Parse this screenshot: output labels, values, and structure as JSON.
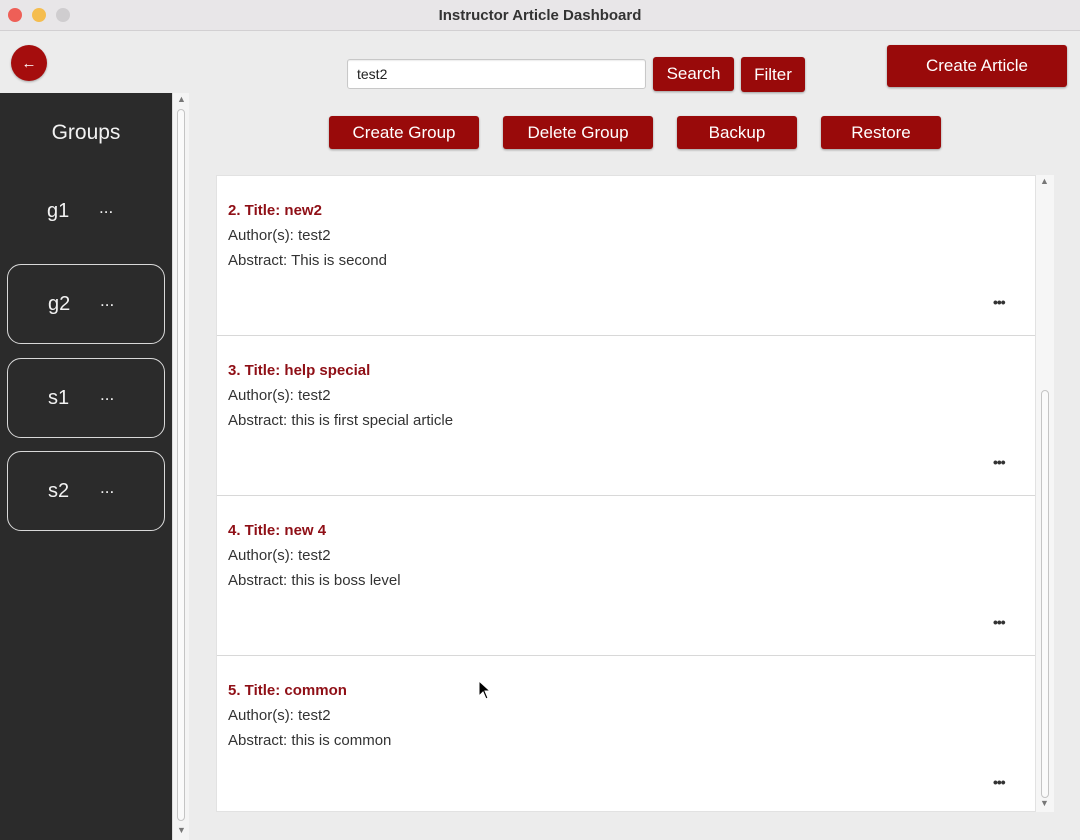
{
  "window": {
    "title": "Instructor Article Dashboard"
  },
  "icons": {
    "back": "arrow-left-icon",
    "more": "ellipsis-icon"
  },
  "colors": {
    "accent": "#990a0a",
    "title_text": "#8f0f16",
    "sidebar_bg": "#2b2b2b"
  },
  "back_button": {
    "label": "←"
  },
  "search": {
    "value": "test2"
  },
  "toolbar": {
    "search_label": "Search",
    "filter_label": "Filter",
    "create_article_label": "Create Article",
    "create_group_label": "Create Group",
    "delete_group_label": "Delete Group",
    "backup_label": "Backup",
    "restore_label": "Restore"
  },
  "sidebar": {
    "title": "Groups",
    "items": [
      {
        "name": "g1",
        "more": "..."
      },
      {
        "name": "g2",
        "more": "..."
      },
      {
        "name": "s1",
        "more": "..."
      },
      {
        "name": "s2",
        "more": "..."
      }
    ]
  },
  "articles": [
    {
      "title": "2. Title: new2",
      "authors": "Author(s): test2",
      "abstract": "Abstract: This is second",
      "more": "•••"
    },
    {
      "title": "3. Title: help special",
      "authors": "Author(s): test2",
      "abstract": "Abstract: this is first special article",
      "more": "•••"
    },
    {
      "title": "4. Title: new 4",
      "authors": "Author(s): test2",
      "abstract": "Abstract: this is boss level",
      "more": "•••"
    },
    {
      "title": "5. Title: common",
      "authors": "Author(s): test2",
      "abstract": "Abstract: this is common",
      "more": "•••"
    }
  ]
}
